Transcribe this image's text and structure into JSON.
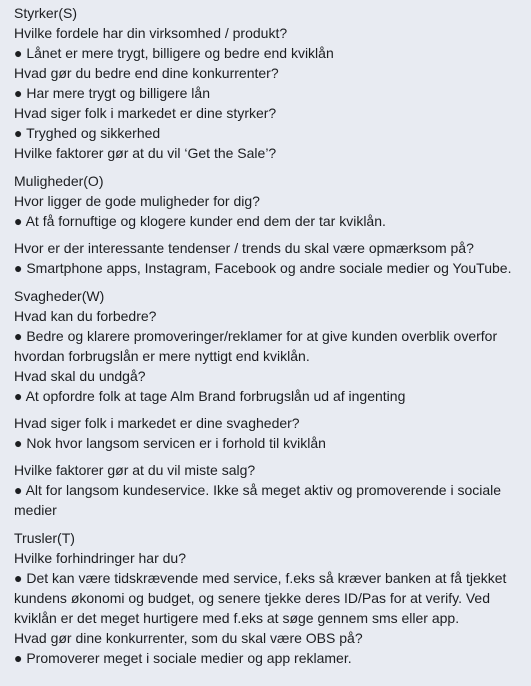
{
  "strengths": {
    "heading": "Styrker(S)",
    "lines": [
      "Hvilke fordele har din virksomhed / produkt?",
      "● Lånet er mere trygt, billigere og bedre end kviklån",
      "Hvad gør du bedre end dine konkurrenter?",
      "● Har mere trygt og billigere lån",
      "Hvad siger folk i markedet er dine styrker?",
      "● Tryghed og sikkerhed",
      "Hvilke faktorer gør at du vil ‘Get the Sale’?"
    ]
  },
  "opportunities": {
    "heading": "Muligheder(O)",
    "lines": [
      "Hvor ligger de gode muligheder for dig?",
      "● At få fornuftige og klogere kunder end dem der tar kviklån."
    ],
    "lines2": [
      "Hvor er der interessante tendenser / trends du skal være opmærksom på?",
      "● Smartphone apps, Instagram, Facebook og andre sociale medier og YouTube."
    ]
  },
  "weaknesses": {
    "heading": "Svagheder(W)",
    "lines": [
      "Hvad kan du forbedre?",
      "● Bedre og klarere promoveringer/reklamer for at give kunden overblik overfor hvordan forbrugslån er mere nyttigt end kviklån.",
      "Hvad skal du undgå?",
      "● At opfordre folk at tage Alm Brand forbrugslån ud af ingenting"
    ],
    "lines2": [
      "Hvad siger folk i markedet er dine svagheder?",
      "● Nok hvor langsom servicen er i forhold til kviklån"
    ],
    "lines3": [
      "Hvilke faktorer gør at du vil miste salg?",
      "● Alt for langsom kundeservice. Ikke så meget aktiv og promoverende i sociale medier"
    ]
  },
  "threats": {
    "heading": "Trusler(T)",
    "lines": [
      "Hvilke forhindringer har du?",
      "● Det kan være tidskrævende med service, f.eks så kræver banken at få tjekket kundens økonomi og budget, og senere tjekke deres ID/Pas for at verify. Ved kviklån er det meget hurtigere med f.eks at søge gennem sms eller app.",
      "Hvad gør dine konkurrenter, som du skal være OBS på?",
      "● Promoverer meget i sociale medier og app reklamer."
    ]
  }
}
